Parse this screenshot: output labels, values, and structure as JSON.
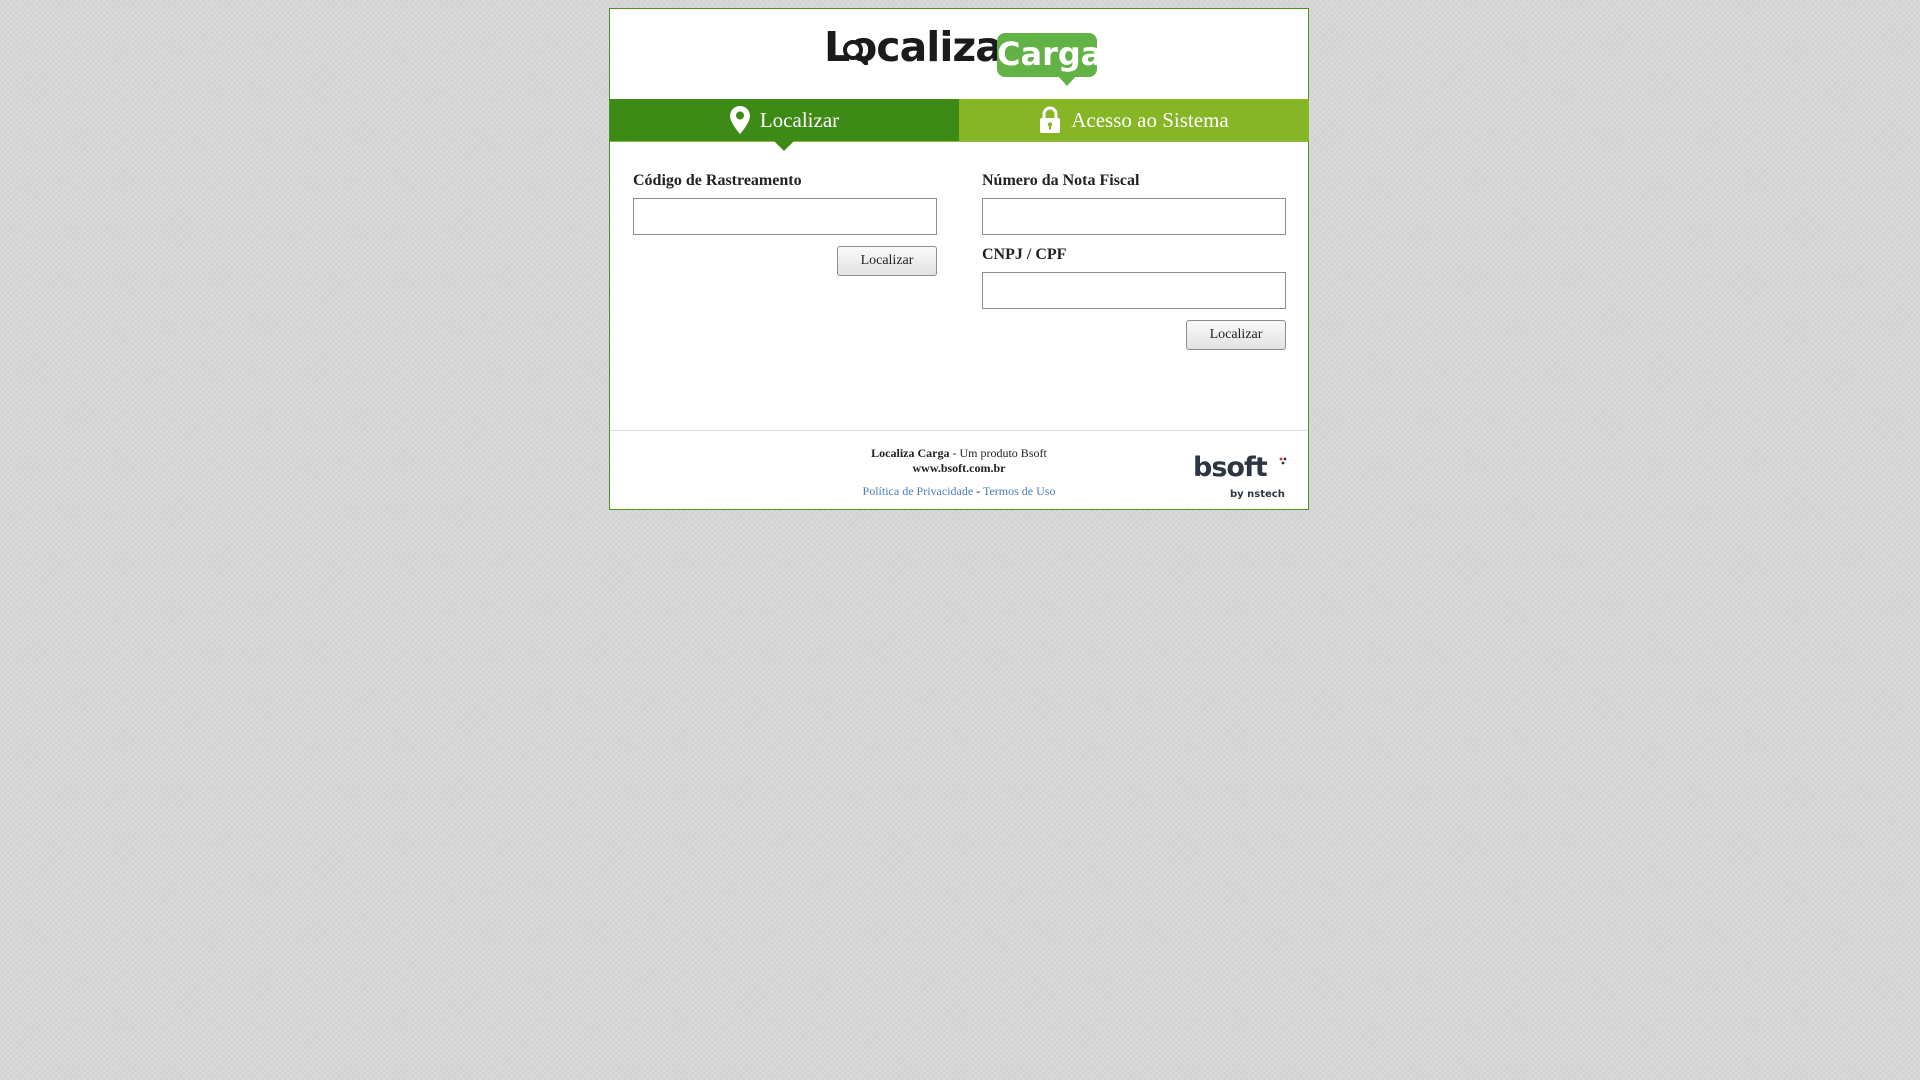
{
  "header": {
    "logo": {
      "text": "Localiza",
      "badge": "Carga",
      "badge_color": "#62b245"
    }
  },
  "tabs": [
    {
      "label": "Localizar",
      "icon": "map-pin-icon",
      "active": true,
      "color": "#3d8a16"
    },
    {
      "label": "Acesso ao Sistema",
      "icon": "lock-icon",
      "active": false,
      "color": "#86b526"
    }
  ],
  "left_form": {
    "label": "Código de Rastreamento",
    "value": "",
    "button": "Localizar"
  },
  "right_form": {
    "nota_label": "Número da Nota Fiscal",
    "nota_value": "",
    "cnpj_label": "CNPJ / CPF",
    "cnpj_value": "",
    "button": "Localizar"
  },
  "footer": {
    "product_name": "Localiza Carga",
    "product_suffix": " - Um produto Bsoft",
    "website": "www.bsoft.com.br",
    "privacy_link": "Política de Privacidade",
    "separator": " - ",
    "terms_link": "Termos de Uso",
    "bsoft_logo": {
      "text": "bsoft",
      "sub": "by nstech",
      "accent": "#d5312c"
    }
  }
}
